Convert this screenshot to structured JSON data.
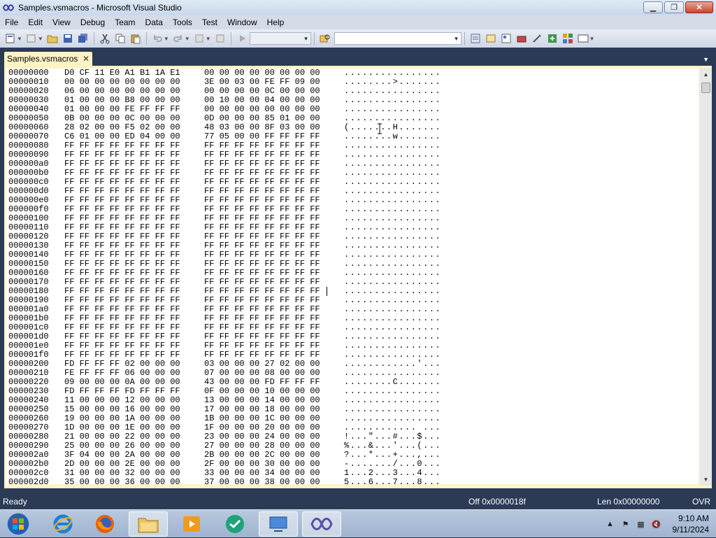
{
  "window": {
    "title": "Samples.vsmacros - Microsoft Visual Studio"
  },
  "menu": [
    "File",
    "Edit",
    "View",
    "Debug",
    "Team",
    "Data",
    "Tools",
    "Test",
    "Window",
    "Help"
  ],
  "tab": {
    "label": "Samples.vsmacros",
    "close": "✕"
  },
  "hex_rows": [
    {
      "off": "00000000",
      "b1": "D0 CF 11 E0 A1 B1 1A E1",
      "b2": "00 00 00 00 00 00 00 00",
      "ascii": "................"
    },
    {
      "off": "00000010",
      "b1": "00 00 00 00 00 00 00 00",
      "b2": "3E 00 03 00 FE FF 09 00",
      "ascii": "........>......."
    },
    {
      "off": "00000020",
      "b1": "06 00 00 00 00 00 00 00",
      "b2": "00 00 00 00 0C 00 00 00",
      "ascii": "................"
    },
    {
      "off": "00000030",
      "b1": "01 00 00 00 B8 00 00 00",
      "b2": "00 10 00 00 04 00 00 00",
      "ascii": "................"
    },
    {
      "off": "00000040",
      "b1": "01 00 00 00 FE FF FF FF",
      "b2": "00 00 00 00 00 00 00 00",
      "ascii": "................"
    },
    {
      "off": "00000050",
      "b1": "0B 00 00 00 0C 00 00 00",
      "b2": "0D 00 00 00 85 01 00 00",
      "ascii": "................"
    },
    {
      "off": "00000060",
      "b1": "28 02 00 00 F5 02 00 00",
      "b2": "48 03 00 00 8F 03 00 00",
      "ascii": "(.......H......."
    },
    {
      "off": "00000070",
      "b1": "C6 01 00 00 ED 04 00 00",
      "b2": "77 05 00 00 FF FF FF FF",
      "ascii": "........w......."
    },
    {
      "off": "00000080",
      "b1": "FF FF FF FF FF FF FF FF",
      "b2": "FF FF FF FF FF FF FF FF",
      "ascii": "................"
    },
    {
      "off": "00000090",
      "b1": "FF FF FF FF FF FF FF FF",
      "b2": "FF FF FF FF FF FF FF FF",
      "ascii": "................"
    },
    {
      "off": "000000a0",
      "b1": "FF FF FF FF FF FF FF FF",
      "b2": "FF FF FF FF FF FF FF FF",
      "ascii": "................"
    },
    {
      "off": "000000b0",
      "b1": "FF FF FF FF FF FF FF FF",
      "b2": "FF FF FF FF FF FF FF FF",
      "ascii": "................"
    },
    {
      "off": "000000c0",
      "b1": "FF FF FF FF FF FF FF FF",
      "b2": "FF FF FF FF FF FF FF FF",
      "ascii": "................"
    },
    {
      "off": "000000d0",
      "b1": "FF FF FF FF FF FF FF FF",
      "b2": "FF FF FF FF FF FF FF FF",
      "ascii": "................"
    },
    {
      "off": "000000e0",
      "b1": "FF FF FF FF FF FF FF FF",
      "b2": "FF FF FF FF FF FF FF FF",
      "ascii": "................"
    },
    {
      "off": "000000f0",
      "b1": "FF FF FF FF FF FF FF FF",
      "b2": "FF FF FF FF FF FF FF FF",
      "ascii": "................"
    },
    {
      "off": "00000100",
      "b1": "FF FF FF FF FF FF FF FF",
      "b2": "FF FF FF FF FF FF FF FF",
      "ascii": "................"
    },
    {
      "off": "00000110",
      "b1": "FF FF FF FF FF FF FF FF",
      "b2": "FF FF FF FF FF FF FF FF",
      "ascii": "................"
    },
    {
      "off": "00000120",
      "b1": "FF FF FF FF FF FF FF FF",
      "b2": "FF FF FF FF FF FF FF FF",
      "ascii": "................"
    },
    {
      "off": "00000130",
      "b1": "FF FF FF FF FF FF FF FF",
      "b2": "FF FF FF FF FF FF FF FF",
      "ascii": "................"
    },
    {
      "off": "00000140",
      "b1": "FF FF FF FF FF FF FF FF",
      "b2": "FF FF FF FF FF FF FF FF",
      "ascii": "................"
    },
    {
      "off": "00000150",
      "b1": "FF FF FF FF FF FF FF FF",
      "b2": "FF FF FF FF FF FF FF FF",
      "ascii": "................"
    },
    {
      "off": "00000160",
      "b1": "FF FF FF FF FF FF FF FF",
      "b2": "FF FF FF FF FF FF FF FF",
      "ascii": "................"
    },
    {
      "off": "00000170",
      "b1": "FF FF FF FF FF FF FF FF",
      "b2": "FF FF FF FF FF FF FF FF",
      "ascii": "................"
    },
    {
      "off": "00000180",
      "b1": "FF FF FF FF FF FF FF FF",
      "b2": "FF FF FF FF FF FF FF FF",
      "ascii": "................"
    },
    {
      "off": "00000190",
      "b1": "FF FF FF FF FF FF FF FF",
      "b2": "FF FF FF FF FF FF FF FF",
      "ascii": "................"
    },
    {
      "off": "000001a0",
      "b1": "FF FF FF FF FF FF FF FF",
      "b2": "FF FF FF FF FF FF FF FF",
      "ascii": "................"
    },
    {
      "off": "000001b0",
      "b1": "FF FF FF FF FF FF FF FF",
      "b2": "FF FF FF FF FF FF FF FF",
      "ascii": "................"
    },
    {
      "off": "000001c0",
      "b1": "FF FF FF FF FF FF FF FF",
      "b2": "FF FF FF FF FF FF FF FF",
      "ascii": "................"
    },
    {
      "off": "000001d0",
      "b1": "FF FF FF FF FF FF FF FF",
      "b2": "FF FF FF FF FF FF FF FF",
      "ascii": "................"
    },
    {
      "off": "000001e0",
      "b1": "FF FF FF FF FF FF FF FF",
      "b2": "FF FF FF FF FF FF FF FF",
      "ascii": "................"
    },
    {
      "off": "000001f0",
      "b1": "FF FF FF FF FF FF FF FF",
      "b2": "FF FF FF FF FF FF FF FF",
      "ascii": "................"
    },
    {
      "off": "00000200",
      "b1": "FD FF FF FF 02 00 00 00",
      "b2": "03 00 00 00 27 02 00 00",
      "ascii": "............'..."
    },
    {
      "off": "00000210",
      "b1": "FE FF FF FF 06 00 00 00",
      "b2": "07 00 00 00 08 00 00 00",
      "ascii": "................"
    },
    {
      "off": "00000220",
      "b1": "09 00 00 00 0A 00 00 00",
      "b2": "43 00 00 00 FD FF FF FF",
      "ascii": "........C......."
    },
    {
      "off": "00000230",
      "b1": "FD FF FF FF FD FF FF FF",
      "b2": "0F 00 00 00 10 00 00 00",
      "ascii": "................"
    },
    {
      "off": "00000240",
      "b1": "11 00 00 00 12 00 00 00",
      "b2": "13 00 00 00 14 00 00 00",
      "ascii": "................"
    },
    {
      "off": "00000250",
      "b1": "15 00 00 00 16 00 00 00",
      "b2": "17 00 00 00 18 00 00 00",
      "ascii": "................"
    },
    {
      "off": "00000260",
      "b1": "19 00 00 00 1A 00 00 00",
      "b2": "1B 00 00 00 1C 00 00 00",
      "ascii": "................"
    },
    {
      "off": "00000270",
      "b1": "1D 00 00 00 1E 00 00 00",
      "b2": "1F 00 00 00 20 00 00 00",
      "ascii": "............ ..."
    },
    {
      "off": "00000280",
      "b1": "21 00 00 00 22 00 00 00",
      "b2": "23 00 00 00 24 00 00 00",
      "ascii": "!...\"...#...$..."
    },
    {
      "off": "00000290",
      "b1": "25 00 00 00 26 00 00 00",
      "b2": "27 00 00 00 28 00 00 00",
      "ascii": "%...&...'...(..."
    },
    {
      "off": "000002a0",
      "b1": "3F 04 00 00 2A 00 00 00",
      "b2": "2B 00 00 00 2C 00 00 00",
      "ascii": "?...*...+...,..."
    },
    {
      "off": "000002b0",
      "b1": "2D 00 00 00 2E 00 00 00",
      "b2": "2F 00 00 00 30 00 00 00",
      "ascii": "-......./...0..."
    },
    {
      "off": "000002c0",
      "b1": "31 00 00 00 32 00 00 00",
      "b2": "33 00 00 00 34 00 00 00",
      "ascii": "1...2...3...4..."
    },
    {
      "off": "000002d0",
      "b1": "35 00 00 00 36 00 00 00",
      "b2": "37 00 00 00 38 00 00 00",
      "ascii": "5...6...7...8..."
    }
  ],
  "status": {
    "left": "Ready",
    "offset": "Off 0x0000018f",
    "length": "Len 0x00000000",
    "mode": "OVR"
  },
  "clock": {
    "time": "9:10 AM",
    "date": "9/11/2024"
  },
  "colors": {
    "chrome": "#2b3a55",
    "tab": "#fdf3c5",
    "menubar": "#d6dbe9"
  },
  "taskbar_items": [
    "start-orb-icon",
    "internet-explorer-icon",
    "firefox-icon",
    "file-explorer-icon",
    "media-player-icon",
    "chat-app-icon",
    "remote-desktop-icon",
    "visual-studio-icon"
  ]
}
